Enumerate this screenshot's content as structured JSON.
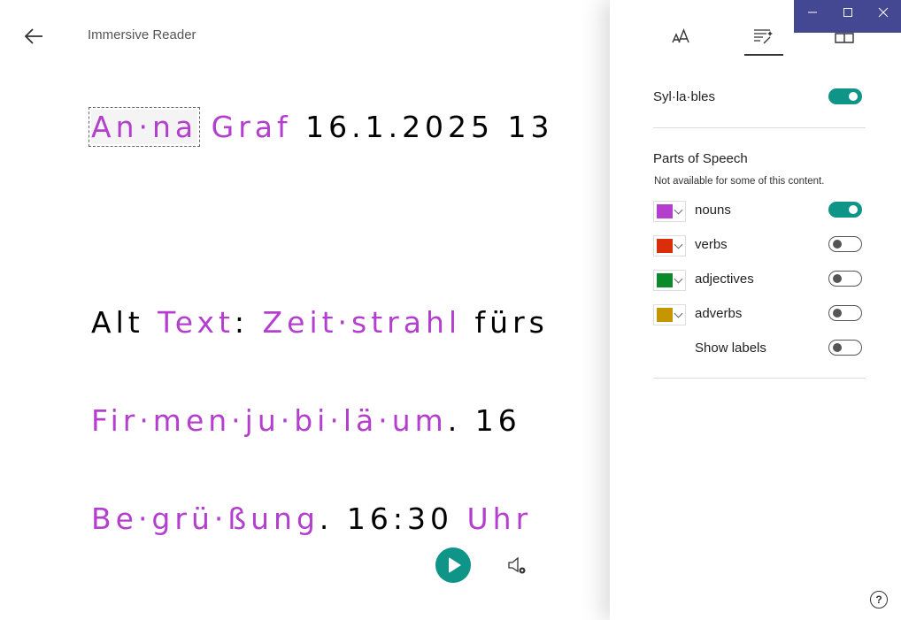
{
  "header": {
    "title": "Immersive Reader",
    "back_icon": "arrow-left-icon"
  },
  "reader": {
    "lines": [
      [
        {
          "text": "An·na",
          "pos": "noun",
          "selected": true
        },
        {
          "text": " "
        },
        {
          "text": "Graf",
          "pos": "noun"
        },
        {
          "text": " 16.1.2025 13"
        }
      ],
      [
        {
          "text": "Alt "
        },
        {
          "text": "Text",
          "pos": "noun"
        },
        {
          "text": ": "
        },
        {
          "text": "Zeit·strahl",
          "pos": "noun"
        },
        {
          "text": " fürs"
        }
      ],
      [
        {
          "text": "Fir·men·ju·bi·lä·um",
          "pos": "noun"
        },
        {
          "text": ". 16"
        }
      ],
      [
        {
          "text": "Be·grü·ßung",
          "pos": "noun"
        },
        {
          "text": ". 16:30 "
        },
        {
          "text": "Uhr",
          "pos": "noun"
        }
      ]
    ]
  },
  "player": {
    "play_icon": "play-icon",
    "voice_settings_icon": "voice-settings-icon"
  },
  "panel": {
    "tabs": [
      {
        "name": "text-preferences",
        "icon": "font-size-icon",
        "active": false
      },
      {
        "name": "grammar-options",
        "icon": "grammar-wand-icon",
        "active": true
      },
      {
        "name": "reading-preferences",
        "icon": "book-icon",
        "active": false
      }
    ],
    "syllables": {
      "label": "Syl·la·bles",
      "on": true
    },
    "parts_of_speech": {
      "title": "Parts of Speech",
      "note": "Not available for some of this content.",
      "items": [
        {
          "label": "nouns",
          "color": "#b43fce",
          "on": true
        },
        {
          "label": "verbs",
          "color": "#d92e0a",
          "on": false
        },
        {
          "label": "adjectives",
          "color": "#0a8a2a",
          "on": false
        },
        {
          "label": "adverbs",
          "color": "#c49600",
          "on": false
        }
      ],
      "show_labels": {
        "label": "Show labels",
        "on": false
      }
    },
    "help_label": "?"
  },
  "window": {
    "minimize": "minimize-icon",
    "maximize": "maximize-icon",
    "close": "close-icon"
  }
}
